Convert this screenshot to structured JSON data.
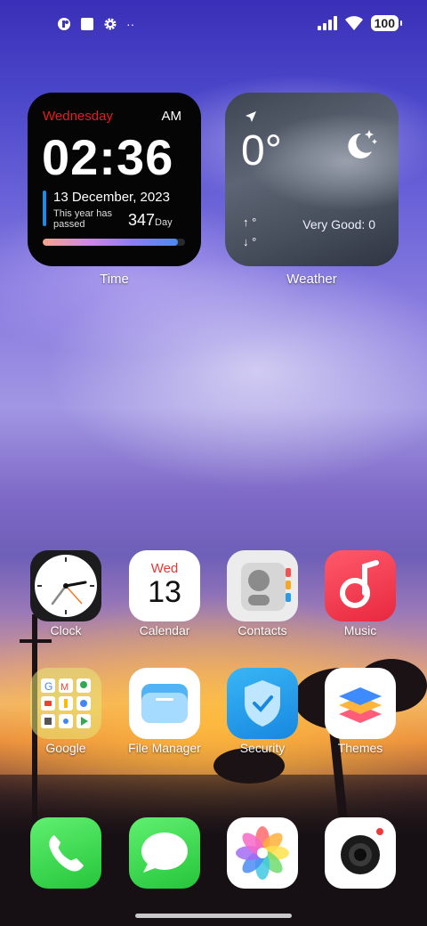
{
  "status_bar": {
    "battery": "100",
    "icons": [
      "notification-icon",
      "square-app-icon",
      "settings-gear-icon",
      "more-dots-icon",
      "signal-bars-icon",
      "wifi-icon",
      "battery-icon"
    ],
    "more": "··"
  },
  "time_widget": {
    "day": "Wednesday",
    "ampm": "AM",
    "time": "02:36",
    "date": "13 December, 2023",
    "passed_label": "This year has passed",
    "days_count": "347",
    "days_unit": "Day",
    "year_progress": 0.95,
    "label": "Time",
    "accent_color": "#e81c1c"
  },
  "weather_widget": {
    "temperature": "0°",
    "high": "°",
    "low": "°",
    "aqi": "Very Good: 0",
    "label": "Weather",
    "icon": "moon-stars-icon"
  },
  "apps_row1": [
    {
      "label": "Clock",
      "icon": "clock-icon"
    },
    {
      "label": "Calendar",
      "icon": "calendar-icon",
      "weekday": "Wed",
      "day": "13"
    },
    {
      "label": "Contacts",
      "icon": "contacts-icon"
    },
    {
      "label": "Music",
      "icon": "music-icon"
    }
  ],
  "apps_row2": [
    {
      "label": "Google",
      "icon": "google-folder-icon"
    },
    {
      "label": "File Manager",
      "icon": "folder-icon"
    },
    {
      "label": "Security",
      "icon": "shield-icon"
    },
    {
      "label": "Themes",
      "icon": "layers-icon"
    }
  ],
  "dock": [
    {
      "icon": "phone-icon"
    },
    {
      "icon": "messages-icon"
    },
    {
      "icon": "photos-icon"
    },
    {
      "icon": "camera-icon"
    }
  ]
}
